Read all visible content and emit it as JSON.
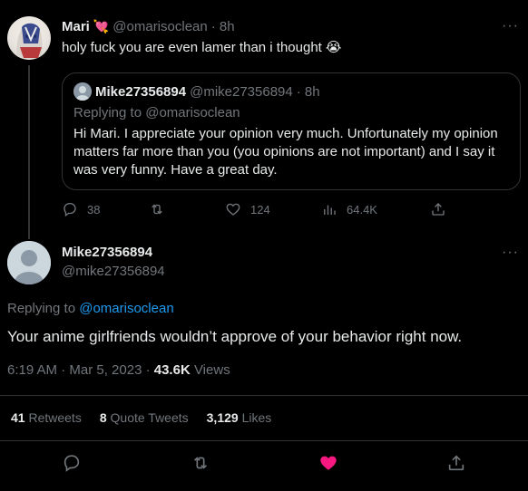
{
  "reply": {
    "name": "Mari",
    "handle": "@omarisoclean",
    "time": "· 8h",
    "text": "holy fuck you are even lamer than i thought",
    "emoji": "😭",
    "name_emoji": "💘"
  },
  "quote": {
    "name": "Mike27356894",
    "handle": "@mike27356894",
    "time": "· 8h",
    "replying": "Replying to @omarisoclean",
    "body": "Hi Mari. I appreciate your opinion very much. Unfortunately my opinion matters far more than you (you opinions are not important) and I say it was very funny. Have a great day."
  },
  "reply_actions": {
    "replies": "38",
    "retweets": "",
    "likes": "124",
    "views": "64.4K"
  },
  "main": {
    "name": "Mike27356894",
    "handle": "@mike27356894",
    "replying_prefix": "Replying to ",
    "replying_handle": "@omarisoclean",
    "text": "Your anime girlfriends wouldn’t approve of your behavior right now.",
    "timestamp": "6:19 AM · Mar 5, 2023 · ",
    "views_count": "43.6K",
    "views_label": " Views"
  },
  "stats": {
    "retweets_count": "41",
    "retweets_label": " Retweets",
    "quotes_count": "8",
    "quotes_label": " Quote Tweets",
    "likes_count": "3,129",
    "likes_label": " Likes"
  },
  "icons": {
    "reply": "reply-icon",
    "retweet": "retweet-icon",
    "like": "heart-icon",
    "views": "views-icon",
    "share": "share-icon",
    "more": "more-icon"
  },
  "colors": {
    "accent": "#1d9bf0",
    "like_active": "#f91880",
    "muted": "#71767b",
    "border": "#2f3336"
  }
}
